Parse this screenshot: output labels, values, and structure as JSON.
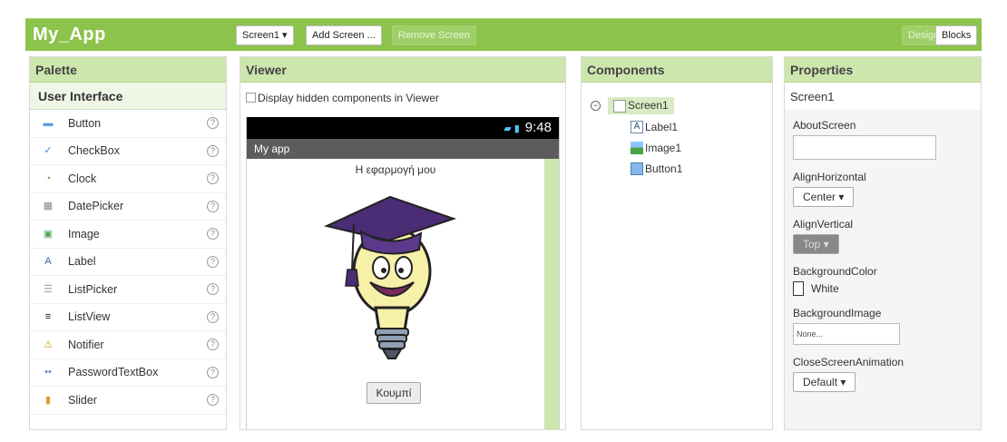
{
  "app": {
    "title": "My_App"
  },
  "toolbar": {
    "screen": "Screen1 ▾",
    "add_screen": "Add Screen ...",
    "remove_screen": "Remove Screen",
    "designer": "Designer",
    "blocks": "Blocks"
  },
  "palette": {
    "title": "Palette",
    "category": "User Interface",
    "help": "?",
    "items": [
      {
        "label": "Button",
        "icon": "button-icon"
      },
      {
        "label": "CheckBox",
        "icon": "checkbox-icon"
      },
      {
        "label": "Clock",
        "icon": "clock-icon"
      },
      {
        "label": "DatePicker",
        "icon": "datepicker-icon"
      },
      {
        "label": "Image",
        "icon": "image-icon"
      },
      {
        "label": "Label",
        "icon": "label-icon"
      },
      {
        "label": "ListPicker",
        "icon": "listpicker-icon"
      },
      {
        "label": "ListView",
        "icon": "listview-icon"
      },
      {
        "label": "Notifier",
        "icon": "notifier-icon"
      },
      {
        "label": "PasswordTextBox",
        "icon": "passwordtextbox-icon"
      },
      {
        "label": "Slider",
        "icon": "slider-icon"
      }
    ]
  },
  "viewer": {
    "title": "Viewer",
    "display_hidden": "Display hidden components in Viewer",
    "time": "9:48",
    "app_title": "My app",
    "label_text": "Η εφαρμογή μου",
    "button_text": "Κουμπί"
  },
  "components": {
    "title": "Components",
    "screen": "Screen1",
    "children": [
      "Label1",
      "Image1",
      "Button1"
    ]
  },
  "properties": {
    "title": "Properties",
    "screen": "Screen1",
    "about": "AboutScreen",
    "align_h": "AlignHorizontal",
    "align_h_value": "Center  ▾",
    "align_v": "AlignVertical",
    "align_v_value": "Top    ▾",
    "bg_color": "BackgroundColor",
    "bg_color_value": "White",
    "bg_image": "BackgroundImage",
    "bg_image_value": "None...",
    "close_anim": "CloseScreenAnimation",
    "close_anim_value": "Default         ▾"
  }
}
